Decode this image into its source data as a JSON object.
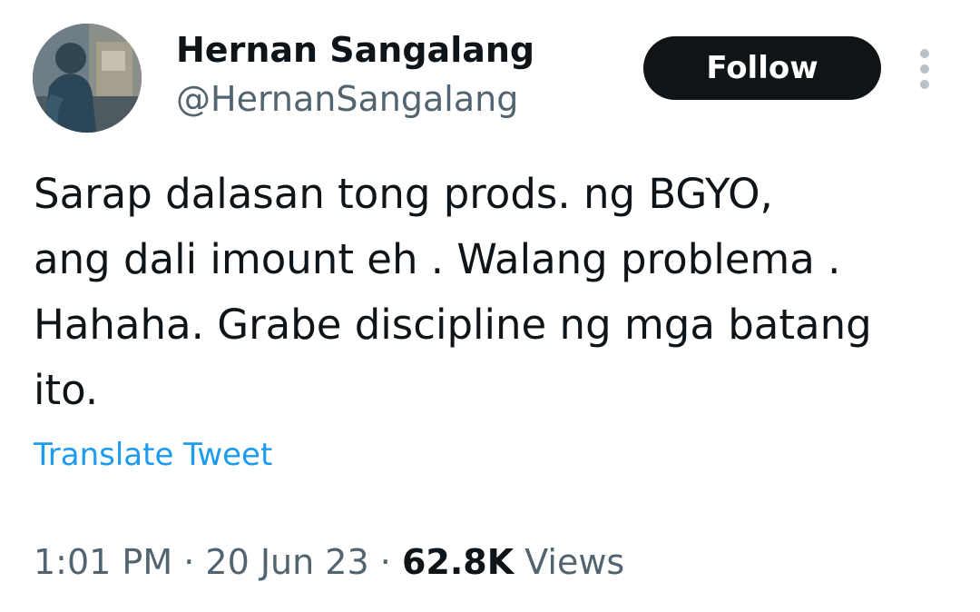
{
  "author": {
    "display_name": "Hernan Sangalang",
    "handle": "@HernanSangalang"
  },
  "actions": {
    "follow_label": "Follow"
  },
  "tweet": {
    "lines": [
      "Sarap dalasan tong prods. ng BGYO,",
      "ang dali imount eh . Walang problema .",
      "Hahaha. Grabe discipline ng mga batang",
      "ito."
    ],
    "translate_label": "Translate Tweet"
  },
  "meta": {
    "time": "1:01 PM",
    "separator": "·",
    "date": "20 Jun 23",
    "views_count": "62.8K",
    "views_label": "Views"
  },
  "colors": {
    "text_primary": "#0f1419",
    "text_secondary": "#536471",
    "link": "#1d9bf0",
    "follow_bg": "#0f1419"
  }
}
